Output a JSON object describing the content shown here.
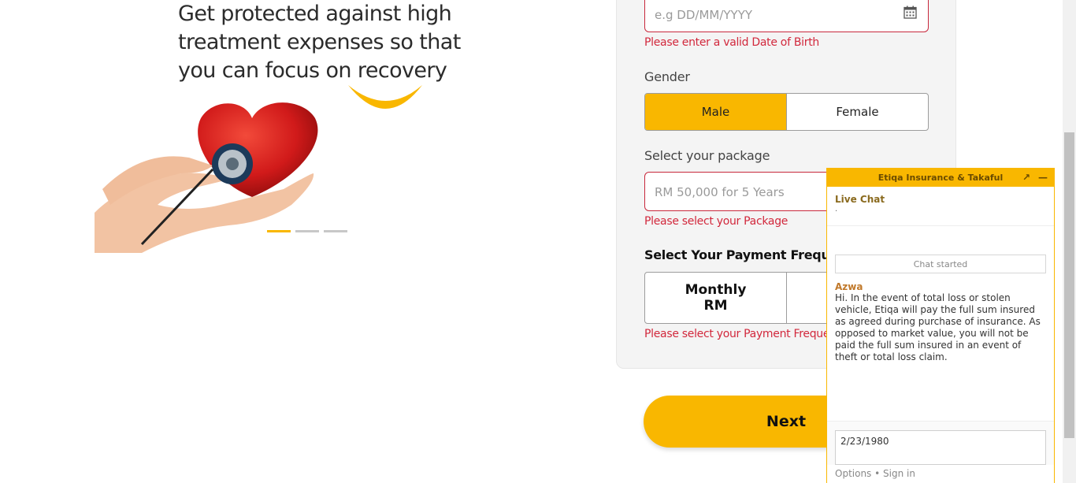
{
  "hero": {
    "title_line1": "Get protected against high",
    "title_line2": "treatment expenses so that",
    "title_line3": "you can focus on recovery",
    "image_icon": "heart-stethoscope-image",
    "carousel": {
      "count": 3,
      "active": 0
    }
  },
  "form": {
    "dob": {
      "placeholder": "e.g DD/MM/YYYY",
      "error": "Please enter a valid Date of Birth"
    },
    "gender": {
      "label": "Gender",
      "options": [
        "Male",
        "Female"
      ],
      "selected": "Male"
    },
    "package": {
      "label": "Select your package",
      "placeholder": "RM 50,000 for 5 Years",
      "error": "Please select your Package"
    },
    "payment": {
      "label": "Select Your Payment Frequency",
      "options": [
        {
          "line1": "Monthly",
          "line2": "RM"
        }
      ],
      "error": "Please select your Payment Frequency"
    },
    "next_label": "Next"
  },
  "chat": {
    "header_title": "Etiqa Insurance & Takaful",
    "popout_icon": "↗",
    "minimize_icon": "—",
    "live_label": "Live Chat",
    "live_sub": ".",
    "chat_started": "Chat started",
    "agent_name": "Azwa",
    "agent_message": "Hi. In the event of total loss or stolen vehicle, Etiqa will pay the full sum insured as agreed during purchase of insurance. As opposed to market value, you will not be paid the full sum insured in an event of theft or total loss claim.",
    "input_value": "2/23/1980",
    "footer_options": "Options",
    "footer_sep": "•",
    "footer_signin": "Sign in"
  },
  "colors": {
    "accent": "#f9b700",
    "error": "#d2283c"
  }
}
